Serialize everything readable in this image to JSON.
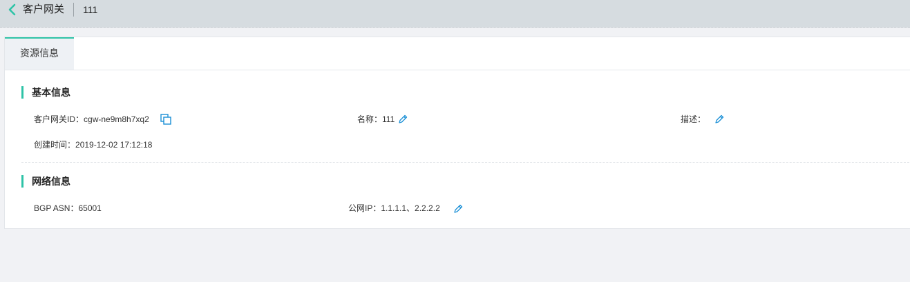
{
  "header": {
    "title": "客户网关",
    "resource_id": "111"
  },
  "tabs": [
    {
      "label": "资源信息",
      "active": true
    }
  ],
  "basic_info": {
    "section_title": "基本信息",
    "gateway_id_label": "客户网关ID：",
    "gateway_id_value": "cgw-ne9m8h7xq2",
    "name_label": "名称：",
    "name_value": "111",
    "description_label": "描述：",
    "description_value": "",
    "created_label": "创建时间：",
    "created_value": "2019-12-02 17:12:18"
  },
  "network_info": {
    "section_title": "网络信息",
    "bgp_asn_label": "BGP ASN：",
    "bgp_asn_value": "65001",
    "public_ip_label": "公网IP：",
    "public_ip_value": "1.1.1.1、2.2.2.2"
  },
  "colors": {
    "accent": "#2ec3a7",
    "icon_blue": "#1a8fd6",
    "header_bg": "#d6dce0"
  },
  "icons": {
    "back": "chevron-left-icon",
    "copy": "copy-icon",
    "edit": "pencil-icon"
  }
}
